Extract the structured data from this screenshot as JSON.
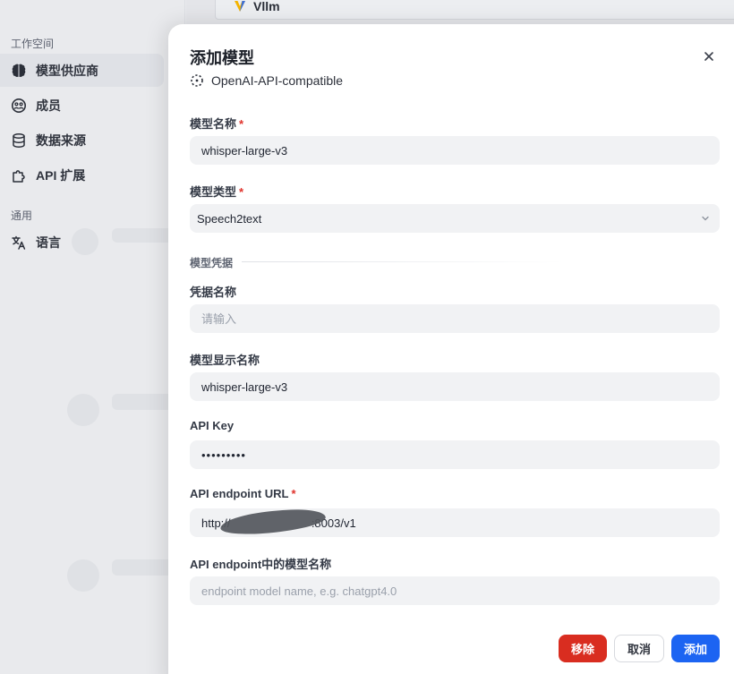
{
  "sidebar": {
    "workspace_label": "工作空间",
    "general_label": "通用",
    "items": [
      {
        "label": "模型供应商",
        "icon": "brain-icon",
        "active": true
      },
      {
        "label": "成员",
        "icon": "members-icon",
        "active": false
      },
      {
        "label": "数据来源",
        "icon": "database-icon",
        "active": false
      },
      {
        "label": "API 扩展",
        "icon": "puzzle-icon",
        "active": false
      }
    ],
    "language_label": "语言"
  },
  "background": {
    "provider_name": "Vllm"
  },
  "modal": {
    "title": "添加模型",
    "provider": "OpenAI-API-compatible",
    "fields": {
      "model_name": {
        "label": "模型名称",
        "value": "whisper-large-v3",
        "required": true
      },
      "model_type": {
        "label": "模型类型",
        "value": "Speech2text",
        "required": true
      },
      "credentials_section": "模型凭据",
      "credential_name": {
        "label": "凭据名称",
        "placeholder": "请输入"
      },
      "display_name": {
        "label": "模型显示名称",
        "value": "whisper-large-v3"
      },
      "api_key": {
        "label": "API Key",
        "value": "•••••••••"
      },
      "endpoint_url": {
        "label": "API endpoint URL",
        "value": "http://                         :8003/v1",
        "required": true
      },
      "endpoint_model_name": {
        "label": "API endpoint中的模型名称",
        "placeholder": "endpoint model name, e.g. chatgpt4.0"
      }
    },
    "buttons": {
      "remove": "移除",
      "cancel": "取消",
      "add": "添加"
    }
  },
  "colors": {
    "primary": "#1c64f2",
    "danger": "#d92d20",
    "required": "#e0332c",
    "input_bg": "#f1f2f4"
  }
}
